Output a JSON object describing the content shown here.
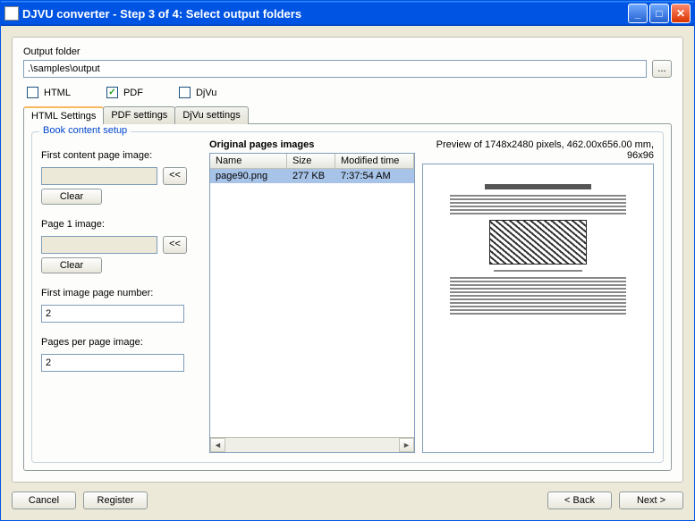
{
  "titlebar": {
    "text": "DJVU converter - Step 3 of 4: Select output folders"
  },
  "output": {
    "label": "Output folder",
    "value": ".\\samples\\output",
    "browse": "..."
  },
  "formats": {
    "html": "HTML",
    "pdf": "PDF",
    "djvu": "DjVu"
  },
  "tabs": {
    "html": "HTML Settings",
    "pdf": "PDF settings",
    "djvu": "DjVu settings"
  },
  "fieldset": {
    "legend": "Book content setup"
  },
  "left": {
    "first_content_label": "First content page image:",
    "page1_label": "Page 1 image:",
    "clear": "Clear",
    "arrow": "<<",
    "first_num_label": "First image page number:",
    "first_num_value": "2",
    "pages_per_label": "Pages per page image:",
    "pages_per_value": "2"
  },
  "list": {
    "title": "Original pages images",
    "cols": {
      "name": "Name",
      "size": "Size",
      "time": "Modified time"
    },
    "row": {
      "name": "page90.png",
      "size": "277 KB",
      "time": "7:37:54 AM"
    }
  },
  "preview": {
    "text": "Preview of 1748x2480 pixels, 462.00x656.00 mm, 96x96"
  },
  "buttons": {
    "cancel": "Cancel",
    "register": "Register",
    "back": "< Back",
    "next": "Next >"
  }
}
